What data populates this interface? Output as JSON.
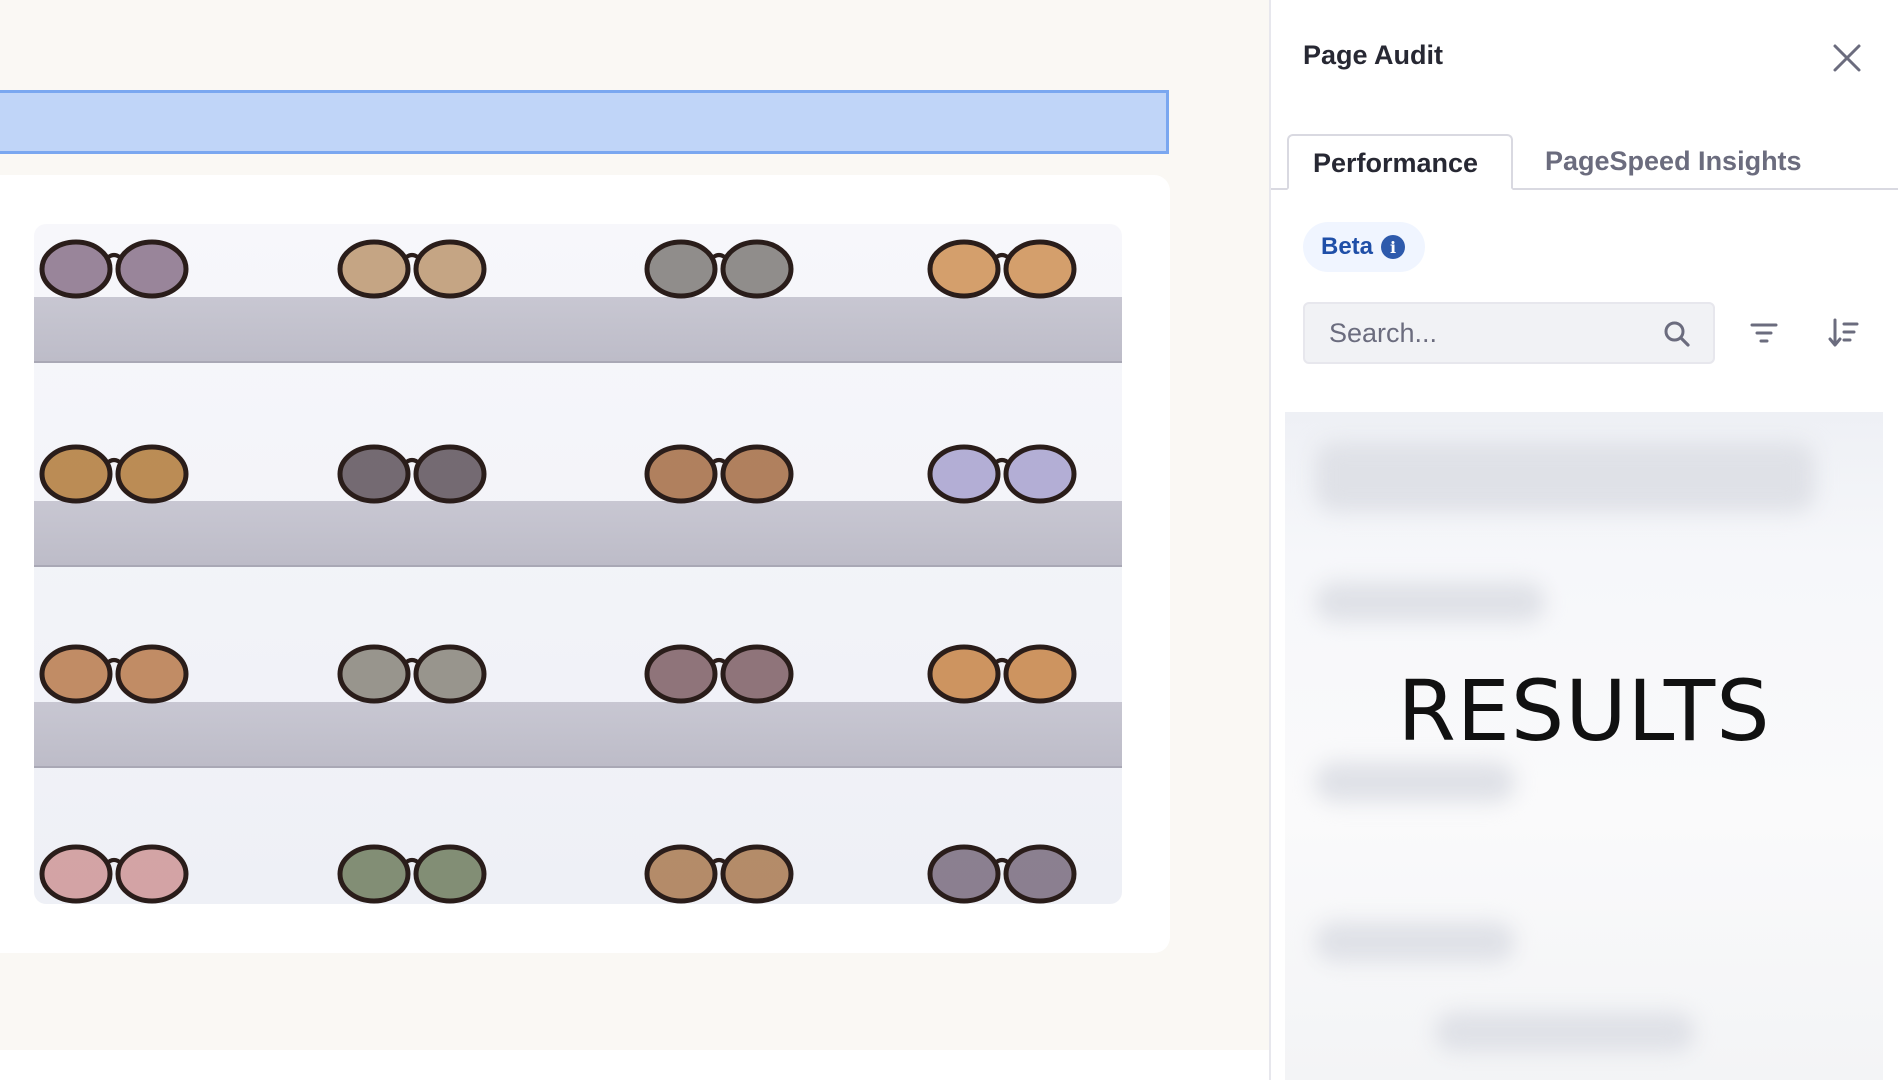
{
  "panel": {
    "title": "Page Audit",
    "close_icon": "close-icon",
    "tabs": [
      {
        "label": "Performance",
        "active": true
      },
      {
        "label": "PageSpeed Insights",
        "active": false
      }
    ],
    "beta_badge": {
      "label": "Beta",
      "icon": "info-icon"
    },
    "search": {
      "placeholder": "Search...",
      "value": "",
      "icon": "search-icon"
    },
    "filter_icon": "filter-icon",
    "sort_icon": "sort-icon",
    "results_label": "RESULTS"
  },
  "canvas": {
    "image_subject": "sunglasses on shelves"
  },
  "colors": {
    "accent": "#2e5aac",
    "selection_fill": "#c0d5f8",
    "selection_border": "#7aa7f0"
  }
}
